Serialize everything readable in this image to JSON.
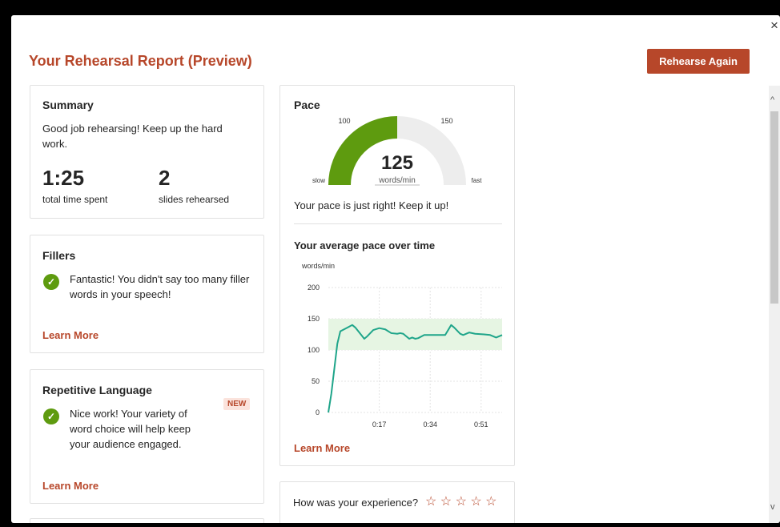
{
  "header": {
    "title": "Your Rehearsal Report (Preview)",
    "rehearse_again": "Rehearse Again",
    "close_glyph": "×"
  },
  "summary": {
    "heading": "Summary",
    "message": "Good job rehearsing! Keep up the hard work.",
    "time_value": "1:25",
    "time_label": "total time spent",
    "slides_value": "2",
    "slides_label": "slides rehearsed"
  },
  "fillers": {
    "heading": "Fillers",
    "message": "Fantastic! You didn't say too many filler words in your speech!",
    "learn_more": "Learn More"
  },
  "repetitive": {
    "heading": "Repetitive Language",
    "badge": "NEW",
    "message": "Nice work! Your variety of word choice will help keep your audience engaged.",
    "learn_more": "Learn More"
  },
  "pace": {
    "heading": "Pace",
    "gauge": {
      "value": "125",
      "unit": "words/min",
      "label_slow": "slow",
      "label_fast": "fast",
      "tick_low": "100",
      "tick_high": "150",
      "fill_fraction": 0.5,
      "color_fill": "#5E9B0F",
      "color_track": "#EDEDED"
    },
    "message": "Your pace is just right! Keep it up!",
    "chart_heading": "Your average pace over time",
    "learn_more": "Learn More"
  },
  "chart_data": {
    "type": "line",
    "title": "Your average pace over time",
    "ylabel": "words/min",
    "xlabel": "",
    "ylim": [
      0,
      200
    ],
    "yticks": [
      "0",
      "50",
      "100",
      "150",
      "200"
    ],
    "xticks": [
      {
        "label": "0:17",
        "x": 17
      },
      {
        "label": "0:34",
        "x": 34
      },
      {
        "label": "0:51",
        "x": 51
      }
    ],
    "xlim": [
      0,
      58
    ],
    "band": [
      100,
      150
    ],
    "band_color": "#E6F5E3",
    "line_color": "#1FA58A",
    "grid": true,
    "series": [
      {
        "values": [
          [
            0,
            0
          ],
          [
            1,
            30
          ],
          [
            2,
            70
          ],
          [
            3,
            110
          ],
          [
            4,
            130
          ],
          [
            6,
            135
          ],
          [
            8,
            140
          ],
          [
            9,
            136
          ],
          [
            11,
            124
          ],
          [
            12,
            118
          ],
          [
            13,
            122
          ],
          [
            15,
            132
          ],
          [
            17,
            135
          ],
          [
            19,
            133
          ],
          [
            21,
            127
          ],
          [
            23,
            126
          ],
          [
            24,
            127
          ],
          [
            25,
            126
          ],
          [
            27,
            118
          ],
          [
            28,
            120
          ],
          [
            29,
            118
          ],
          [
            30,
            119
          ],
          [
            32,
            124
          ],
          [
            34,
            124
          ],
          [
            36,
            124
          ],
          [
            39,
            124
          ],
          [
            41,
            140
          ],
          [
            42,
            136
          ],
          [
            44,
            126
          ],
          [
            45,
            124
          ],
          [
            47,
            128
          ],
          [
            49,
            126
          ],
          [
            52,
            125
          ],
          [
            54,
            124
          ],
          [
            56,
            120
          ],
          [
            58,
            124
          ]
        ]
      }
    ]
  },
  "feedback": {
    "question": "How was your experience?",
    "stars": "☆ ☆ ☆ ☆ ☆"
  }
}
